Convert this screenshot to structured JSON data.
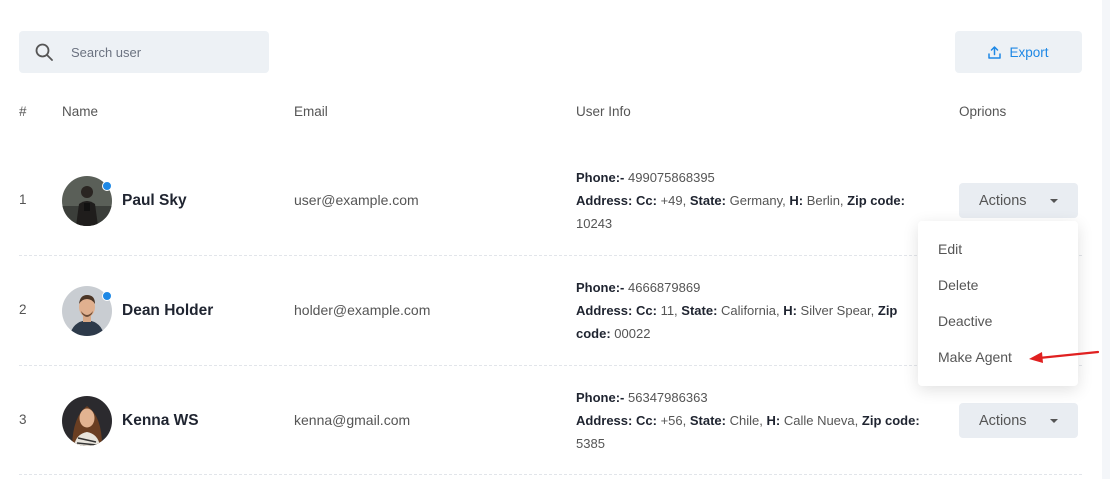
{
  "search": {
    "placeholder": "Search user",
    "icon": "search-icon"
  },
  "toolbar": {
    "export_label": "Export",
    "export_icon": "upload-icon"
  },
  "table": {
    "headers": {
      "num": "#",
      "name": "Name",
      "email": "Email",
      "info": "User Info",
      "options": "Oprions"
    },
    "rows": [
      {
        "num": "1",
        "name": "Paul Sky",
        "email": "user@example.com",
        "phone_label": "Phone:-",
        "phone": "499075868395",
        "address_label": "Address:",
        "cc_label": "Cc:",
        "cc": "+49,",
        "state_label": "State:",
        "state": "Germany,",
        "h_label": "H:",
        "h": "Berlin,",
        "zip_label": "Zip code:",
        "zip": "10243",
        "online": true,
        "actions_label": "Actions"
      },
      {
        "num": "2",
        "name": "Dean Holder",
        "email": "holder@example.com",
        "phone_label": "Phone:-",
        "phone": "4666879869",
        "address_label": "Address:",
        "cc_label": "Cc:",
        "cc": "11,",
        "state_label": "State:",
        "state": "California,",
        "h_label": "H:",
        "h": "Silver Spear,",
        "zip_label": "Zip code:",
        "zip": "00022",
        "online": true
      },
      {
        "num": "3",
        "name": "Kenna WS",
        "email": "kenna@gmail.com",
        "phone_label": "Phone:-",
        "phone": "56347986363",
        "address_label": "Address:",
        "cc_label": "Cc:",
        "cc": "+56,",
        "state_label": "State:",
        "state": "Chile,",
        "h_label": "H:",
        "h": "Calle Nueva,",
        "zip_label": "Zip code:",
        "zip": "5385",
        "online": false,
        "actions_label": "Actions"
      }
    ]
  },
  "dropdown": {
    "items": [
      "Edit",
      "Delete",
      "Deactive",
      "Make Agent"
    ]
  },
  "colors": {
    "accent": "#1e88e5",
    "arrow": "#e02020"
  }
}
